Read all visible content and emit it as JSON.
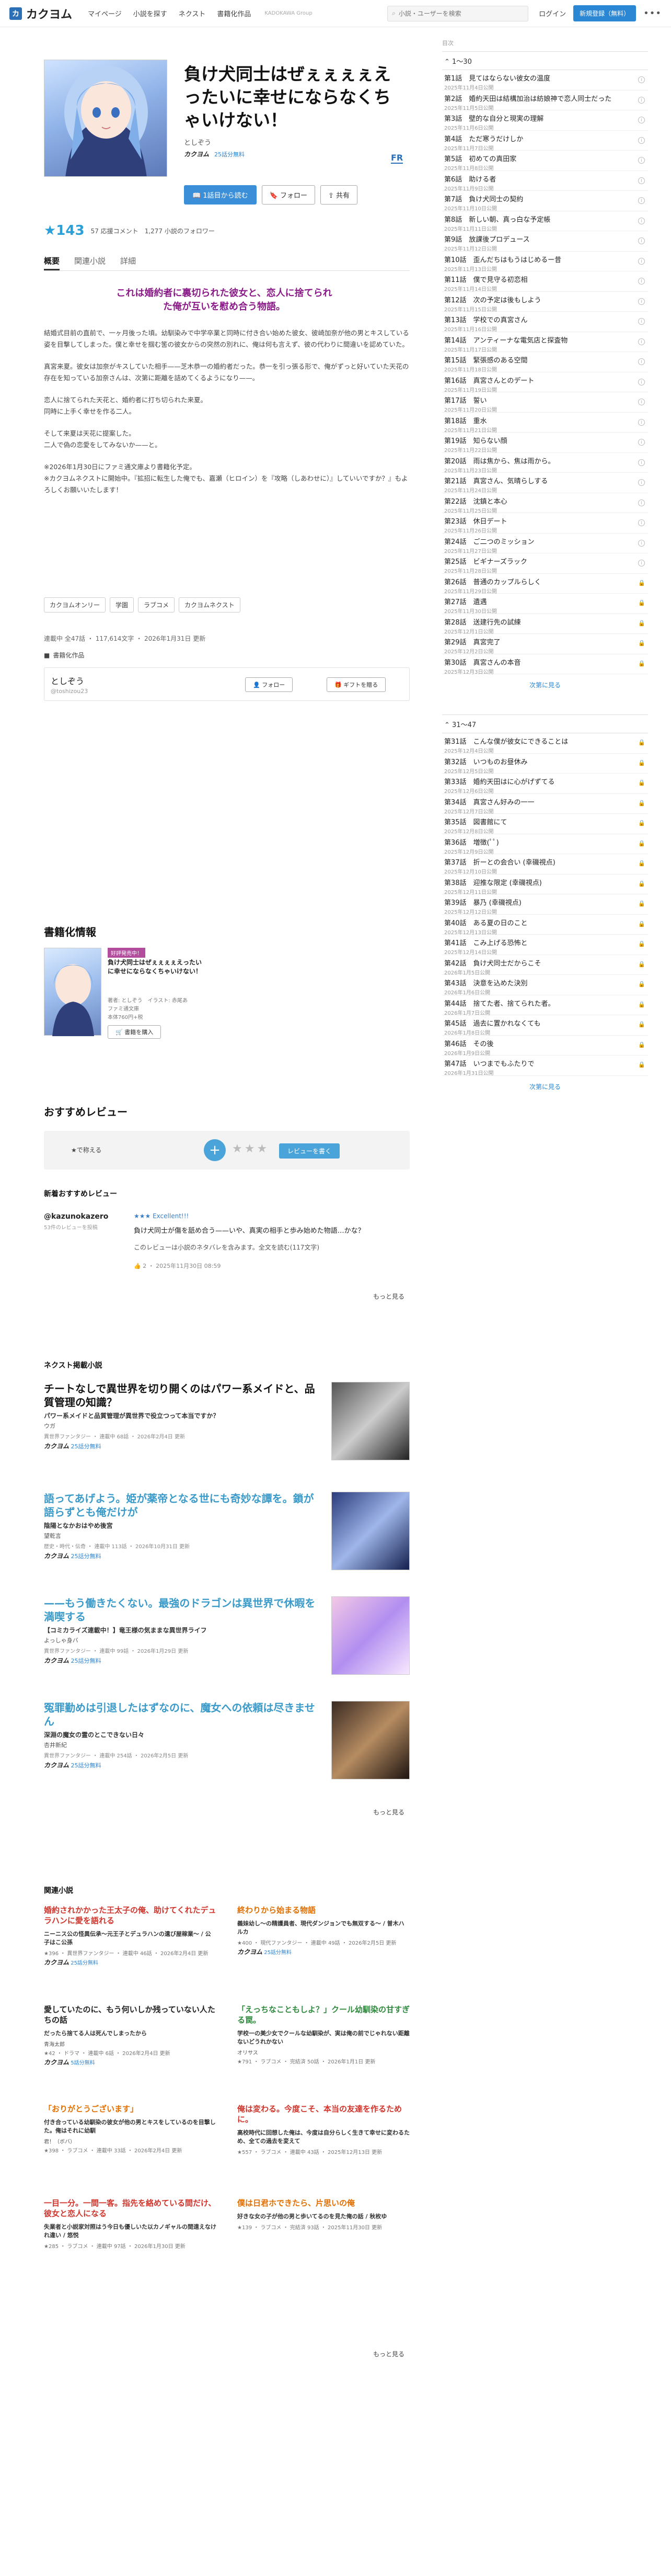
{
  "header": {
    "logo_text": "カクヨム",
    "logo_mark": "カ",
    "nav": [
      "マイページ",
      "小説を探す",
      "ネクスト",
      "書籍化作品"
    ],
    "tagline": "KADOKAWA Group",
    "search_placeholder": "小説・ユーザーを検索",
    "login": "ログイン",
    "register": "新規登録（無料）",
    "more": "•••"
  },
  "work": {
    "title": "負け犬同士はぜぇぇぇぇえったいに幸せにならなくちゃいけない！",
    "author": "としぞう",
    "badge_kak": "カクヨム",
    "badge_free": "25話分無料",
    "fr": "FR",
    "read_button": "1話目から読む",
    "follow_button": "フォロー",
    "share_button": "共有",
    "stars": "★143",
    "stats": [
      "57 応援コメント",
      "1,277 小説のフォロワー"
    ],
    "tabs": [
      "概要",
      "関連小説",
      "詳細"
    ],
    "catch": "これは婚約者に裏切られた彼女と、恋人に捨てられた俺が互いを慰め合う物語。",
    "intro": [
      "結婚式目前の直前で、一ヶ月後った頃。幼馴染みで中学卒業と同時に付き合い始めた彼女、彼崎加奈が他の男とキスしている姿を目撃してしまった。僕と幸せを掴む筈の彼女からの突然の別れに、俺は何も言えず、彼の代わりに間違いを認めていた。",
      "真宮来夏。彼女は加奈がキスしていた相手——芝木恭一の婚約者だった。恭一を引っ張る形で、俺がずっと好いていた天花の存在を知っている加奈さんは、次第に距離を詰めてくるようになり——。",
      "恋人に捨てられた天花と、婚約者に打ち切られた来夏。\n同時に上手く幸せを作る二人。",
      "そして来夏は天花に提案した。\n二人で偽の恋愛をしてみないか——と。",
      "※2026年1月30日にファミ通文庫より書籍化予定。\n※カクヨムネクストに開始中。『拡招に転生した俺でも、嘉瀬（ヒロイン）を『攻略（しあわせに）』していいですか？』もよろしくお願いいたします！"
    ],
    "tags": [
      "カクヨムオンリー",
      "学園",
      "ラブコメ",
      "カクヨムネクスト"
    ],
    "meta": "連載中 全47話 ・ 117,614文字 ・ 2026年1月31日 更新",
    "book_line": "書籍化作品",
    "author_box": {
      "name": "としぞう",
      "uid": "@toshizou23",
      "follow": "フォロー",
      "gift": "ギフトを贈る"
    }
  },
  "book": {
    "section": "書籍化情報",
    "badge": "好評発売中！",
    "title": "負け犬同士はぜぇぇぇぇえったいに幸せにならなくちゃいけない！",
    "author_line": "著者: としぞう　イラスト: 赤尾あ",
    "label": "ファミ通文庫",
    "price": "本体760円+税",
    "button": "書籍を購入"
  },
  "review": {
    "section": "おすすめレビュー",
    "prompt": "★で称える",
    "plus": "+",
    "stars": "★★★",
    "button": "レビューを書く",
    "new_label": "新着おすすめレビュー",
    "user": "@kazunokazero",
    "user_sub": "53件のレビューを投稿",
    "rating": "★★★ Excellent!!!",
    "title": "負け犬同士が傷を舐め合う——いや、真実の相手と歩み始めた物語…かな？",
    "spoiler": "このレビューは小説のネタバレを含みます。全文を読む(117文字)",
    "footer": "👍 2 ・ 2025年11月30日 08:59",
    "more": "もっと見る"
  },
  "next": {
    "section": "ネクスト掲載小説",
    "items": [
      {
        "title": "チートなしで異世界を切り開くのはパワー系メイドと、品質管理の知識？",
        "desc": "パワー系メイドと品質管理が異世界で役立つって本当ですか？",
        "author": "ウガ",
        "meta": "異世界ファンタジー ・ 連載中 68話 ・ 2026年2月4日 更新",
        "badge": "25話分無料"
      },
      {
        "title": "語ってあげよう。姫が薬帝となる世にも奇妙な譚を。鎖が語らずとも俺だけが",
        "desc": "陰陽となかおはやめ後宮",
        "author": "望乾言",
        "meta": "歴史・時代・伝奇 ・ 連載中 113話 ・ 2026年10月31日 更新",
        "badge": "25話分無料"
      },
      {
        "title": "——もう働きたくない。最強のドラゴンは異世界で休暇を満喫する",
        "desc": "【コミカライズ連載中！】竜王様の気ままな異世界ライフ",
        "author": "よっしゃ身バ",
        "meta": "異世界ファンタジー ・ 連載中 99話 ・ 2026年1月29日 更新",
        "badge": "25話分無料"
      },
      {
        "title": "冤罪勤めは引退したはずなのに、魔女への依頼は尽きません",
        "desc": "深淵の魔女の霊のとこできない日々",
        "author": "杏井新紀",
        "meta": "異世界ファンタジー ・ 連載中 254話 ・ 2026年2月5日 更新",
        "badge": "25話分無料"
      }
    ],
    "more": "もっと見る"
  },
  "related": {
    "section": "関連小説",
    "items": [
      {
        "title": "婚約されかかった王太子の俺、助けてくれたデュラハンに愛を語れる",
        "desc": "ニーニス公の怪異伝承〜元王子とデュラハンの遺び屋稼業〜 / 公子はこ公孫",
        "auth": "",
        "meta": "★396 ・ 異世界ファンタジー ・ 連載中 46話 ・ 2026年2月4日 更新",
        "badge": "25話分無料",
        "color": "red"
      },
      {
        "title": "終わりから始まる物語",
        "desc": "義妹幼し〜の精護員者、現代ダンジョンでも無双する〜 / 曽木ハルカ",
        "auth": "",
        "meta": "★400 ・ 現代ファンタジー ・ 連載中 49話 ・ 2026年2月5日 更新",
        "badge": "25話分無料",
        "color": "orange"
      },
      {
        "title": "愛していたのに、もう何いしか残っていない人たちの話",
        "desc": "だったら捨てる人は死んでしまったから",
        "auth": "青海太郎",
        "meta": "★42 ・ ドラマ ・ 連載中 6話 ・ 2026年2月4日 更新",
        "badge": "5話分無料",
        "color": "dark"
      },
      {
        "title": "「えっちなこともしよ？」クール幼馴染の甘すぎる罠。",
        "desc": "学校一の美少女でクールな幼馴染が、実は俺の前でじゃれない距離ないどうれかない",
        "auth": "オリサス",
        "meta": "★791 ・ ラブコメ ・ 完結済 50話 ・ 2026年1月1日 更新",
        "badge": "",
        "color": "green"
      },
      {
        "title": "「おりがとうございます」",
        "desc": "付き合っている幼馴染の彼女が他の男とキスをしているのを目撃した。俺はそれに幼馴",
        "auth": "君！（ボバ）",
        "meta": "★398 ・ ラブコメ ・ 連載中 33話 ・ 2026年2月4日 更新",
        "badge": "",
        "color": "orange"
      },
      {
        "title": "俺は変わる。今度こそ、本当の友達を作るために。",
        "desc": "高校時代に回想した俺は、今度は自分らしく生きて幸せに変わるため、全ての過去を変えて",
        "auth": "",
        "meta": "★557 ・ ラブコメ ・ 連載中 43話 ・ 2025年12月13日 更新",
        "badge": "",
        "color": "red"
      },
      {
        "title": "一目一分。一間一客。指先を絡めている間だけ、彼女と恋人になる",
        "desc": "失業者と小説家対照はう今日も優しいた以カノギャルの間遠えなけれ違い / 悠悦",
        "auth": "",
        "meta": "★285 ・ ラブコメ ・ 連載中 97話 ・ 2026年1月30日 更新",
        "badge": "",
        "color": "red"
      },
      {
        "title": "僕は日君ホできたら、片思いの俺",
        "desc": "好きな女の子が他の男と歩いてるのを見た俺の話 / 秋枚ゆ",
        "auth": "",
        "meta": "★139 ・ ラブコメ ・ 完結済 93話 ・ 2025年11月30日 更新",
        "badge": "",
        "color": "orange"
      }
    ],
    "more": "もっと見る"
  },
  "toc": {
    "label": "目次",
    "group1": "1〜30",
    "group1_eps": [
      [
        "第1話　見てはならない彼女の温度",
        "2025年11月4日公開"
      ],
      [
        "第2話　婚約天田は結構加治は紡娘神で恋人同士だった",
        "2025年11月5日公開"
      ],
      [
        "第3話　壁的な自分と現実の理解",
        "2025年11月6日公開"
      ],
      [
        "第4話　ただ寒うだけしか",
        "2025年11月7日公開"
      ],
      [
        "第5話　初めての真田家",
        "2025年11月8日公開"
      ],
      [
        "第6話　助ける者",
        "2025年11月9日公開"
      ],
      [
        "第7話　負け犬同士の契約",
        "2025年11月10日公開"
      ],
      [
        "第8話　新しい朝、真っ白な予定帳",
        "2025年11月11日公開"
      ],
      [
        "第9話　放課後プロデュース",
        "2025年11月12日公開"
      ],
      [
        "第10話　歪んだちはもうはじめるー昔",
        "2025年11月13日公開"
      ],
      [
        "第11話　僕で見守る初恋相",
        "2025年11月14日公開"
      ],
      [
        "第12話　次の予定は後もしよう",
        "2025年11月15日公開"
      ],
      [
        "第13話　学校での真宮さん",
        "2025年11月16日公開"
      ],
      [
        "第14話　アンティーナな電気店と探査物",
        "2025年11月17日公開"
      ],
      [
        "第15話　緊張感のある空間",
        "2025年11月18日公開"
      ],
      [
        "第16話　真宮さんとのデート",
        "2025年11月19日公開"
      ],
      [
        "第17話　誓い",
        "2025年11月20日公開"
      ],
      [
        "第18話　重水",
        "2025年11月21日公開"
      ],
      [
        "第19話　知らない顔",
        "2025年11月22日公開"
      ],
      [
        "第20話　雨は焦から、焦は雨から。",
        "2025年11月23日公開"
      ],
      [
        "第21話　真宮さん、気晴らしする",
        "2025年11月24日公開"
      ],
      [
        "第22話　沈鎮と本心",
        "2025年11月25日公開"
      ],
      [
        "第23話　休日デート",
        "2025年11月26日公開"
      ],
      [
        "第24話　ご二つのミッション",
        "2025年11月27日公開"
      ],
      [
        "第25話　ビギナーズラック",
        "2025年11月28日公開"
      ],
      [
        "第26話　普通のカップルらしく",
        "2025年11月29日公開"
      ],
      [
        "第27話　遺遇",
        "2025年11月30日公開"
      ],
      [
        "第28話　送建行先の試練",
        "2025年12月1日公開"
      ],
      [
        "第29話　真宮完了",
        "2025年12月2日公開"
      ],
      [
        "第30話　真宮さんの本音",
        "2025年12月3日公開"
      ]
    ],
    "group2": "31〜47",
    "group2_eps": [
      [
        "第31話　こんな僕が彼女にできることは",
        "2025年12月4日公開"
      ],
      [
        "第32話　いつものお昼休み",
        "2025年12月5日公開"
      ],
      [
        "第33話　婚約天田はに心がげずてる",
        "2025年12月6日公開"
      ],
      [
        "第34話　真宮さん好みの一一",
        "2025年12月7日公開"
      ],
      [
        "第35話　図書館にて",
        "2025年12月8日公開"
      ],
      [
        "第36話　増徴(ﾟﾟ)",
        "2025年12月9日公開"
      ],
      [
        "第37話　折ーとの会合い (幸磯視点)",
        "2025年12月10日公開"
      ],
      [
        "第38話　迎推な限定 (幸磯視点)",
        "2025年12月11日公開"
      ],
      [
        "第39話　暴乃 (幸磯視点)",
        "2025年12月12日公開"
      ],
      [
        "第40話　ある夏の日のこと",
        "2025年12月13日公開"
      ],
      [
        "第41話　こみ上げる恐怖と",
        "2025年12月14日公開"
      ],
      [
        "第42話　負け犬同士だからこそ",
        "2026年1月5日公開"
      ],
      [
        "第43話　決意を込めた決別",
        "2026年1月6日公開"
      ],
      [
        "第44話　捨てた者、捨てられた者。",
        "2026年1月7日公開"
      ],
      [
        "第45話　過去に置かれなくても",
        "2026年1月8日公開"
      ],
      [
        "第46話　その後",
        "2026年1月9日公開"
      ],
      [
        "第47話　いつまでもふたりで",
        "2026年1月31日公開"
      ]
    ],
    "more": "次第に見る"
  }
}
